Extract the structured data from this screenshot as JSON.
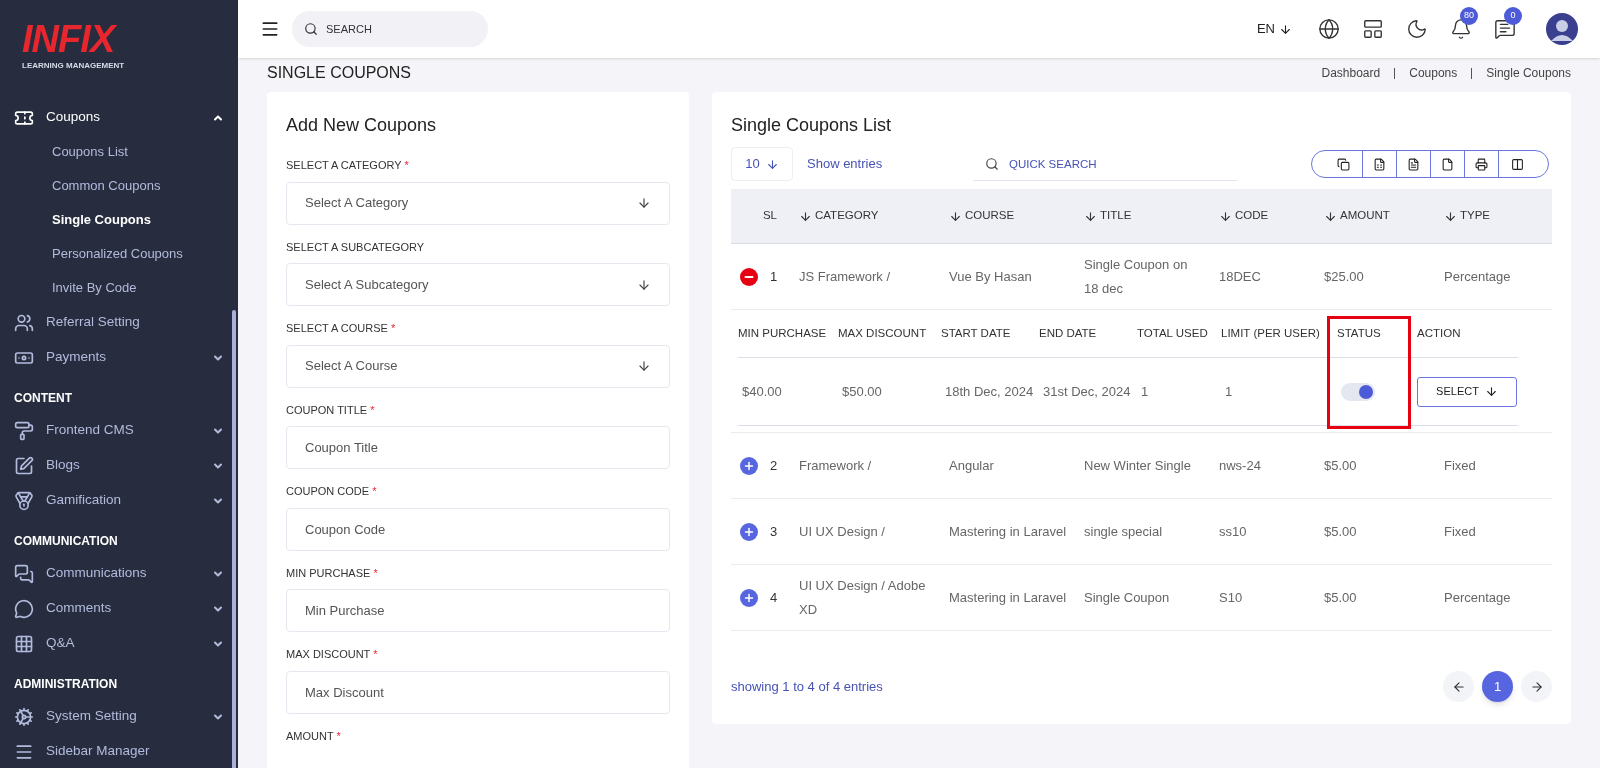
{
  "brand": {
    "logo": "INFIX",
    "tagline": "LEARNING MANAGEMENT"
  },
  "sidebar": {
    "sections": [
      {
        "items": [
          {
            "label": "Coupons",
            "selected": true,
            "expanded": true,
            "children": [
              {
                "label": "Coupons List",
                "selected": false
              },
              {
                "label": "Common Coupons",
                "selected": false
              },
              {
                "label": "Single Coupons",
                "selected": true
              },
              {
                "label": "Personalized Coupons",
                "selected": false
              },
              {
                "label": "Invite By Code",
                "selected": false
              }
            ]
          },
          {
            "label": "Referral Setting",
            "selected": false
          },
          {
            "label": "Payments",
            "selected": false,
            "expanded": false
          }
        ]
      },
      {
        "heading": "CONTENT",
        "items": [
          {
            "label": "Frontend CMS",
            "selected": false,
            "expanded": false
          },
          {
            "label": "Blogs",
            "selected": false,
            "expanded": false
          },
          {
            "label": "Gamification",
            "selected": false,
            "expanded": false
          }
        ]
      },
      {
        "heading": "COMMUNICATION",
        "items": [
          {
            "label": "Communications",
            "selected": false,
            "expanded": false
          },
          {
            "label": "Comments",
            "selected": false,
            "expanded": false
          },
          {
            "label": "Q&A",
            "selected": false,
            "expanded": false
          }
        ]
      },
      {
        "heading": "ADMINISTRATION",
        "items": [
          {
            "label": "System Setting",
            "selected": false,
            "expanded": false
          },
          {
            "label": "Sidebar Manager",
            "selected": false
          }
        ]
      }
    ]
  },
  "topbar": {
    "search": {
      "placeholder": "SEARCH"
    },
    "language": "EN",
    "notifications": "80",
    "messages": "0"
  },
  "page": {
    "title": "SINGLE COUPONS",
    "breadcrumb": [
      "Dashboard",
      "Coupons",
      "Single Coupons"
    ]
  },
  "form": {
    "title": "Add New Coupons",
    "required_mark": "*",
    "fields": [
      {
        "label": "SELECT A CATEGORY",
        "required": true,
        "kind": "select",
        "placeholder": "Select A Category"
      },
      {
        "label": "SELECT A SUBCATEGORY",
        "required": false,
        "kind": "select",
        "placeholder": "Select A Subcategory"
      },
      {
        "label": "SELECT A COURSE",
        "required": true,
        "kind": "select",
        "placeholder": "Select A Course"
      },
      {
        "label": "COUPON TITLE",
        "required": true,
        "kind": "input",
        "placeholder": "Coupon Title"
      },
      {
        "label": "COUPON CODE",
        "required": true,
        "kind": "input",
        "placeholder": "Coupon Code"
      },
      {
        "label": "MIN PURCHASE",
        "required": true,
        "kind": "input",
        "placeholder": "Min Purchase"
      },
      {
        "label": "MAX DISCOUNT",
        "required": true,
        "kind": "input",
        "placeholder": "Max Discount"
      },
      {
        "label": "AMOUNT",
        "required": true
      }
    ]
  },
  "list": {
    "title": "Single Coupons List",
    "page_size": "10",
    "show_entries": "Show entries",
    "search": {
      "placeholder": "QUICK SEARCH"
    },
    "columns": [
      {
        "label": "SL",
        "sortable": false
      },
      {
        "label": "CATEGORY",
        "sortable": true
      },
      {
        "label": "COURSE",
        "sortable": true
      },
      {
        "label": "TITLE",
        "sortable": true
      },
      {
        "label": "CODE",
        "sortable": true
      },
      {
        "label": "AMOUNT",
        "sortable": true
      },
      {
        "label": "TYPE",
        "sortable": true
      }
    ],
    "rows": [
      {
        "sl": "1",
        "category": "JS Framework /",
        "course": "Vue By Hasan",
        "title": "Single Coupon on 18 dec",
        "code": "18DEC",
        "amount": "$25.00",
        "type": "Percentage",
        "expanded": true,
        "detail": {
          "columns": [
            "MIN PURCHASE",
            "MAX DISCOUNT",
            "START DATE",
            "END DATE",
            "TOTAL USED",
            "LIMIT (PER USER)",
            "STATUS",
            "ACTION"
          ],
          "values": [
            "$40.00",
            "$50.00",
            "18th Dec, 2024",
            "31st Dec, 2024",
            "1",
            "1"
          ],
          "status_on": true,
          "action": "SELECT",
          "status_highlighted": true
        }
      },
      {
        "sl": "2",
        "category": "Framework /",
        "course": "Angular",
        "title": "New Winter Single",
        "code": "nws-24",
        "amount": "$5.00",
        "type": "Fixed",
        "expanded": false
      },
      {
        "sl": "3",
        "category": "UI UX Design /",
        "course": "Mastering in Laravel",
        "title": "single special",
        "code": "ss10",
        "amount": "$5.00",
        "type": "Fixed",
        "expanded": false
      },
      {
        "sl": "4",
        "category": "UI UX Design / Adobe XD",
        "course": "Mastering in Laravel",
        "title": "Single Coupon",
        "code": "S10",
        "amount": "$5.00",
        "type": "Percentage",
        "expanded": false
      }
    ],
    "footer": "showing 1 to 4 of 4 entries",
    "pages": [
      {
        "label": "1",
        "selected": true
      }
    ]
  }
}
